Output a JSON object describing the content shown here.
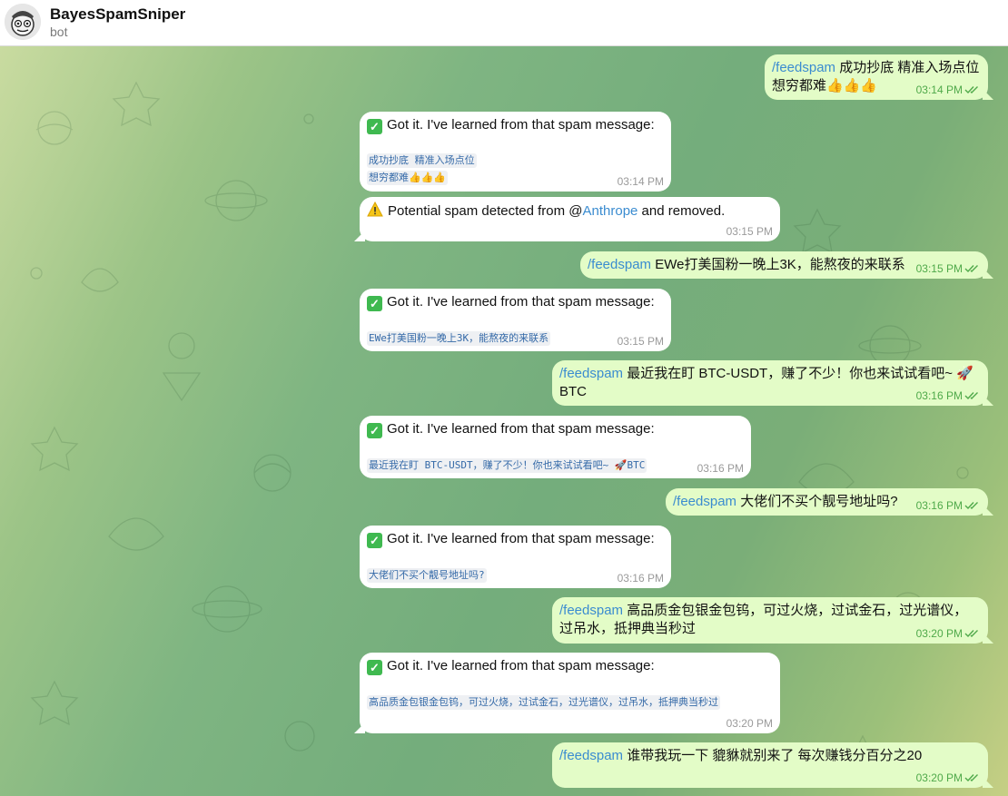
{
  "header": {
    "name": "BayesSpamSniper",
    "subtitle": "bot"
  },
  "messages": {
    "m1": {
      "cmd": "/feedspam",
      "line1": "成功抄底 精准入场点位",
      "line2": "想穷都难👍👍👍",
      "time": "03:14 PM"
    },
    "m2": {
      "title": "Got it. I've learned from that spam message:",
      "code1": "成功抄底 精准入场点位",
      "code2": "想穷都难👍👍👍",
      "time": "03:14 PM"
    },
    "m3": {
      "pre": "Potential spam detected from @",
      "mention": "Anthrope",
      "post": " and removed.",
      "time": "03:15 PM"
    },
    "m4": {
      "cmd": "/feedspam",
      "text": "EWe打美国粉一晚上3K，能熬夜的来联系",
      "time": "03:15 PM"
    },
    "m5": {
      "title": "Got it. I've learned from that spam message:",
      "code": "EWe打美国粉一晚上3K，能熬夜的来联系",
      "time": "03:15 PM"
    },
    "m6": {
      "cmd": "/feedspam",
      "line1": "最近我在盯 BTC-USDT，赚了不少！你也来试试看吧~ 🚀",
      "line2": "BTC",
      "time": "03:16 PM"
    },
    "m7": {
      "title": "Got it. I've learned from that spam message:",
      "code": "最近我在盯 BTC-USDT，赚了不少！你也来试试看吧~ 🚀BTC",
      "time": "03:16 PM"
    },
    "m8": {
      "cmd": "/feedspam",
      "text": "大佬们不买个靓号地址吗?",
      "time": "03:16 PM"
    },
    "m9": {
      "title": "Got it. I've learned from that spam message:",
      "code": "大佬们不买个靓号地址吗?",
      "time": "03:16 PM"
    },
    "m10": {
      "cmd": "/feedspam",
      "line1": "高品质金包银金包钨，可过火烧，过试金石，过光谱仪，",
      "line2": "过吊水，抵押典当秒过",
      "time": "03:20 PM"
    },
    "m11": {
      "title": "Got it. I've learned from that spam message:",
      "code": "高品质金包银金包钨，可过火烧，过试金石，过光谱仪，过吊水，抵押典当秒过",
      "time": "03:20 PM"
    },
    "m12": {
      "cmd": "/feedspam",
      "text": "谁带我玩一下 貔貅就别来了 每次赚钱分百分之20",
      "time": "03:20 PM"
    }
  },
  "colors": {
    "outgoing_bubble": "#e3fcc7",
    "incoming_bubble": "#ffffff",
    "link": "#3b8cd0",
    "read_ticks": "#4fa94a"
  }
}
